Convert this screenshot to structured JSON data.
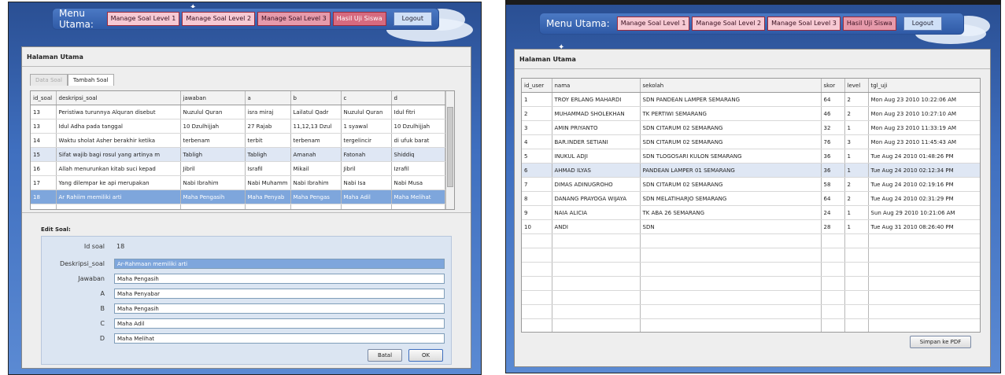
{
  "left": {
    "menu": {
      "label": "Menu Utama:",
      "items": [
        "Manage Soal Level 1",
        "Manage Soal Level 2",
        "Manage Soal Level 3",
        "Hasil Uji Siswa"
      ],
      "logout": "Logout"
    },
    "panel_title": "Halaman Utama",
    "tabs": [
      "Data Soal",
      "Tambah Soal"
    ],
    "table": {
      "headers": [
        "id_soal",
        "deskripsi_soal",
        "jawaban",
        "a",
        "b",
        "c",
        "d"
      ],
      "rows": [
        [
          "13",
          "Peristiwa turunnya Alquran disebut",
          "Nuzulul Quran",
          "isra miraj",
          "Lailatul Qadr",
          "Nuzulul Quran",
          "Idul fitri"
        ],
        [
          "13",
          "Idul Adha pada tanggal",
          "10 Dzulhijjah",
          "27 Rajab",
          "11,12,13 Dzul",
          "1 syawal",
          "10 Dzulhijjah"
        ],
        [
          "14",
          "Waktu sholat Asher berakhir ketika",
          "terbenam",
          "terbit",
          "terbenam",
          "tergelincir",
          "di ufuk barat"
        ],
        [
          "15",
          "Sifat wajib bagi rosul yang artinya m",
          "Tabligh",
          "Tabligh",
          "Amanah",
          "Fatonah",
          "Shiddiq"
        ],
        [
          "16",
          "Allah menurunkan kitab suci kepad",
          "Jibril",
          "Israfil",
          "Mikail",
          "Jibril",
          "Izrafil"
        ],
        [
          "17",
          "Yang dilempar ke api merupakan",
          "Nabi Ibrahim",
          "Nabi Muhamm",
          "Nabi Ibrahim",
          "Nabi Isa",
          "Nabi Musa"
        ],
        [
          "18",
          "Ar Rahiim memiliki arti",
          "Maha Pengasih",
          "Maha Penyab",
          "Maha Pengas",
          "Maha Adil",
          "Maha Melihat"
        ]
      ]
    },
    "edit": {
      "title": "Edit Soal:",
      "id_label": "Id soal",
      "id_value": "18",
      "fields": [
        {
          "label": "Deskripsi_soal",
          "value": "Ar-Rahmaan memiliki arti"
        },
        {
          "label": "Jawaban",
          "value": "Maha Pengasih"
        },
        {
          "label": "A",
          "value": "Maha Penyabar"
        },
        {
          "label": "B",
          "value": "Maha Pengasih"
        },
        {
          "label": "C",
          "value": "Maha Adil"
        },
        {
          "label": "D",
          "value": "Maha Melihat"
        }
      ],
      "batal": "Batal",
      "ok": "OK"
    }
  },
  "right": {
    "menu": {
      "label": "Menu Utama:",
      "items": [
        "Manage Soal Level 1",
        "Manage Soal Level 2",
        "Manage Soal Level 3",
        "Hasil Uji Siswa"
      ],
      "logout": "Logout"
    },
    "panel_title": "Halaman Utama",
    "table": {
      "headers": [
        "id_user",
        "nama",
        "sekolah",
        "skor",
        "level",
        "tgl_uji"
      ],
      "rows": [
        [
          "1",
          "TROY ERLANG MAHARDI",
          "SDN PANDEAN LAMPER SEMARANG",
          "64",
          "2",
          "Mon Aug 23 2010 10:22:06 AM"
        ],
        [
          "2",
          "MUHAMMAD SHOLEKHAN",
          "TK PERTIWI SEMARANG",
          "46",
          "2",
          "Mon Aug 23 2010 10:27:10 AM"
        ],
        [
          "3",
          "AMIN PRIYANTO",
          "SDN CITARUM 02 SEMARANG",
          "32",
          "1",
          "Mon Aug 23 2010 11:33:19 AM"
        ],
        [
          "4",
          "BAR.INDER SETIANI",
          "SDN CITARUM 02 SEMARANG",
          "76",
          "3",
          "Mon Aug 23 2010 11:45:43 AM"
        ],
        [
          "5",
          "INUKUL ADJI",
          "SDN TLOGOSARI KULON SEMARANG",
          "36",
          "1",
          "Tue Aug 24 2010 01:48:26 PM"
        ],
        [
          "6",
          "AHMAD ILYAS",
          "PANDEAN LAMPER 01 SEMARANG",
          "36",
          "1",
          "Tue Aug 24 2010 02:12:34 PM"
        ],
        [
          "7",
          "DIMAS ADINUGROHO",
          "SDN CITARUM 02 SEMARANG",
          "58",
          "2",
          "Tue Aug 24 2010 02:19:16 PM"
        ],
        [
          "8",
          "DANANG PRAYOGA WIJAYA",
          "SDN MELATIHARJO SEMARANG",
          "64",
          "2",
          "Tue Aug 24 2010 02:31:29 PM"
        ],
        [
          "9",
          "NAIA ALICIA",
          "TK ABA 26 SEMARANG",
          "24",
          "1",
          "Sun Aug 29 2010 10:21:06 AM"
        ],
        [
          "10",
          "ANDI",
          "SDN",
          "28",
          "1",
          "Tue Aug 31 2010 08:26:40 PM"
        ]
      ]
    },
    "save_pdf": "Simpan ke PDF"
  }
}
